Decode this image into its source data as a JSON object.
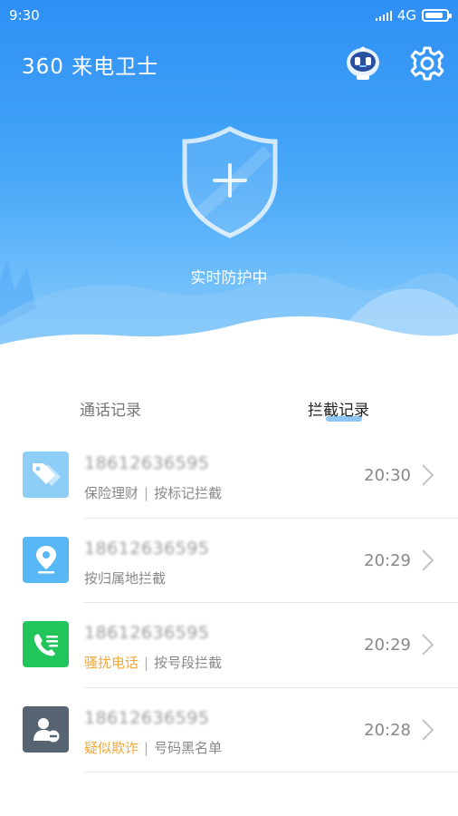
{
  "status_bar": {
    "time": "9:30",
    "network": "4G",
    "battery_level": 0.85
  },
  "header": {
    "title": "360 来电卫士",
    "robot_icon": "robot-avatar-icon",
    "settings_icon": "gear-icon"
  },
  "protection": {
    "status_text": "实时防护中",
    "icon": "shield-plus-icon"
  },
  "tabs": [
    {
      "label": "通话记录",
      "active": false
    },
    {
      "label": "拦截记录",
      "active": true
    }
  ],
  "records": [
    {
      "number": "18612636595",
      "tag": "保险理财",
      "reason": "按标记拦截",
      "time": "20:30",
      "icon": "price-tag-icon",
      "icon_color": "#8ccef5",
      "tag_color": "#888888"
    },
    {
      "number": "18612636595",
      "tag": "按归属地拦截",
      "reason": "",
      "time": "20:29",
      "icon": "location-pin-icon",
      "icon_color": "#58b8f6",
      "tag_color": "#888888"
    },
    {
      "number": "18612636595",
      "tag": "骚扰电话",
      "reason": "按号段拦截",
      "time": "20:29",
      "icon": "phone-list-icon",
      "icon_color": "#22c55a",
      "tag_color": "#f2a93b"
    },
    {
      "number": "18612636595",
      "tag": "疑似欺诈",
      "reason": "号码黑名单",
      "time": "20:28",
      "icon": "blocked-contact-icon",
      "icon_color": "#566371",
      "tag_color": "#f2a93b"
    }
  ]
}
